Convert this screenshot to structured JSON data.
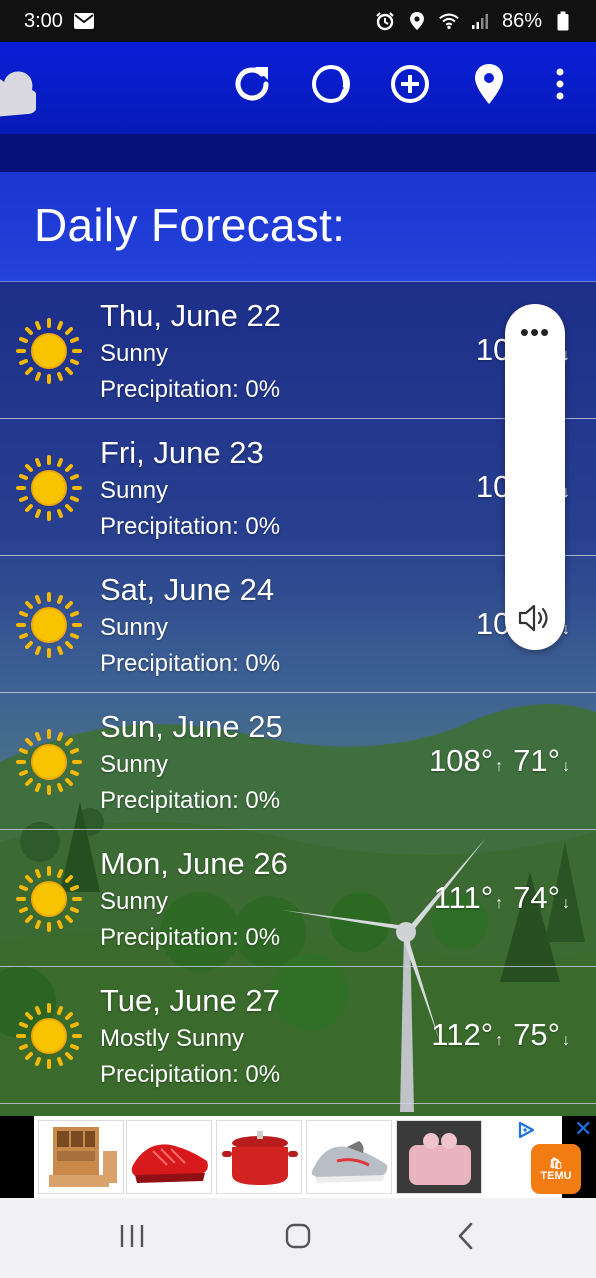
{
  "status_bar": {
    "time": "3:00",
    "battery": "86%",
    "icons": [
      "mail-icon",
      "alarm-icon",
      "location-icon",
      "wifi-icon",
      "signal-icon",
      "battery-icon"
    ]
  },
  "toolbar": {
    "icons": [
      "refresh-icon",
      "moon-phase-icon",
      "add-location-icon",
      "location-pin-icon",
      "overflow-menu-icon"
    ]
  },
  "header": {
    "title": "Daily Forecast:"
  },
  "forecast": [
    {
      "date": "Thu, June 22",
      "condition": "Sunny",
      "precipitation": "Precipitation:  0%",
      "high": "104°",
      "low": ""
    },
    {
      "date": "Fri, June 23",
      "condition": "Sunny",
      "precipitation": "Precipitation:  0%",
      "high": "101°",
      "low": ""
    },
    {
      "date": "Sat, June 24",
      "condition": "Sunny",
      "precipitation": "Precipitation:  0%",
      "high": "104°",
      "low": ""
    },
    {
      "date": "Sun, June 25",
      "condition": "Sunny",
      "precipitation": "Precipitation:  0%",
      "high": "108°",
      "low": "71°"
    },
    {
      "date": "Mon, June 26",
      "condition": "Sunny",
      "precipitation": "Precipitation:  0%",
      "high": "111°",
      "low": "74°"
    },
    {
      "date": "Tue, June 27",
      "condition": "Mostly Sunny",
      "precipitation": "Precipitation:  0%",
      "high": "112°",
      "low": "75°"
    }
  ],
  "arrows": {
    "up": "↑",
    "down": "↓"
  },
  "volume_popup": {
    "menu": "•••"
  },
  "ad": {
    "brand": "TEMU",
    "close": "✕"
  },
  "colors": {
    "appbar": "#0a1fd6",
    "header": "#1b35d4",
    "sun": "#f5b800"
  }
}
